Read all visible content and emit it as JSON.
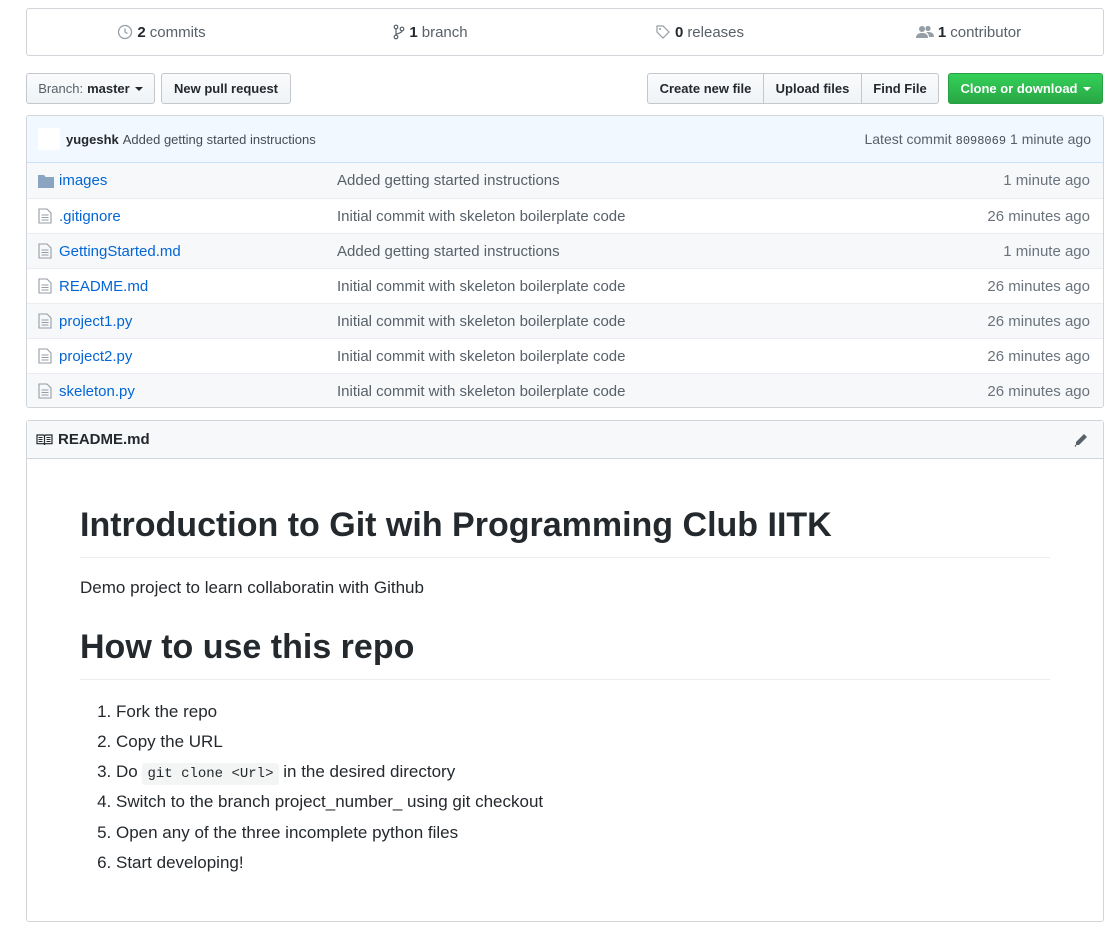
{
  "summary": {
    "commits_count": "2",
    "commits_label": "commits",
    "branches_count": "1",
    "branches_label": "branch",
    "releases_count": "0",
    "releases_label": "releases",
    "contributors_count": "1",
    "contributors_label": "contributor"
  },
  "toolbar": {
    "branch_prefix": "Branch:",
    "branch_name": "master",
    "new_pull_request": "New pull request",
    "create_new_file": "Create new file",
    "upload_files": "Upload files",
    "find_file": "Find File",
    "clone_or_download": "Clone or download"
  },
  "commit": {
    "author": "yugeshk",
    "message": "Added getting started instructions",
    "latest_label": "Latest commit",
    "sha": "8098069",
    "age": "1 minute ago"
  },
  "files": [
    {
      "name": "images",
      "type": "folder",
      "message": "Added getting started instructions",
      "age": "1 minute ago"
    },
    {
      "name": ".gitignore",
      "type": "file",
      "message": "Initial commit with skeleton boilerplate code",
      "age": "26 minutes ago"
    },
    {
      "name": "GettingStarted.md",
      "type": "file",
      "message": "Added getting started instructions",
      "age": "1 minute ago"
    },
    {
      "name": "README.md",
      "type": "file",
      "message": "Initial commit with skeleton boilerplate code",
      "age": "26 minutes ago"
    },
    {
      "name": "project1.py",
      "type": "file",
      "message": "Initial commit with skeleton boilerplate code",
      "age": "26 minutes ago"
    },
    {
      "name": "project2.py",
      "type": "file",
      "message": "Initial commit with skeleton boilerplate code",
      "age": "26 minutes ago"
    },
    {
      "name": "skeleton.py",
      "type": "file",
      "message": "Initial commit with skeleton boilerplate code",
      "age": "26 minutes ago"
    }
  ],
  "readme": {
    "filename": "README.md",
    "title": "Introduction to Git wih Programming Club IITK",
    "intro": "Demo project to learn collaboratin with Github",
    "how_to_heading": "How to use this repo",
    "steps": {
      "s1": "Fork the repo",
      "s2": "Copy the URL",
      "s3_pre": "Do",
      "s3_code": "git clone <Url>",
      "s3_post": "in the desired directory",
      "s4": "Switch to the branch project_number_ using git checkout",
      "s5": "Open any of the three incomplete python files",
      "s6": "Start developing!"
    }
  },
  "colors": {
    "link": "#0366d6",
    "clone_green": "#28a745",
    "commit_bg": "#f1f8ff"
  }
}
